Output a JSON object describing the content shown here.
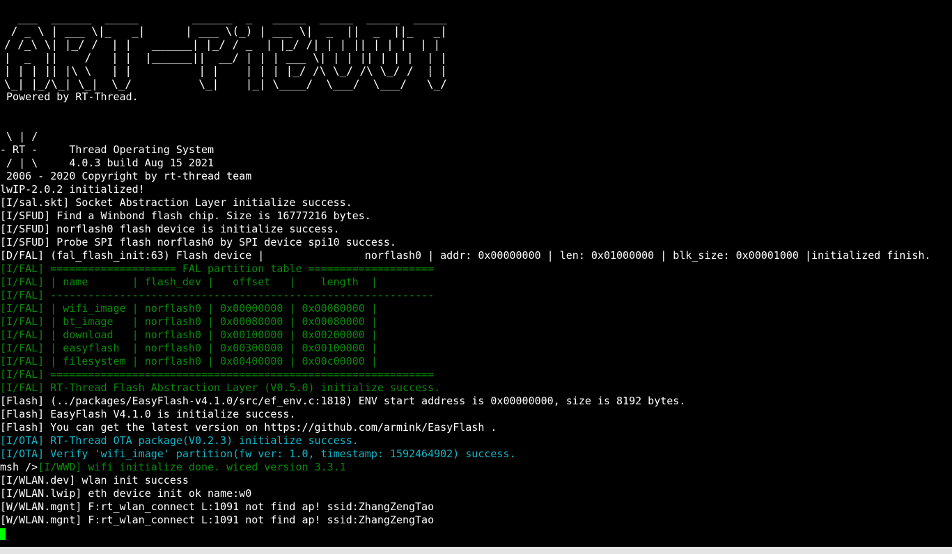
{
  "terminal": {
    "banner_ascii": "  ___  ______  _____        ______  _   _____  _____  _____  _____\n / _ \\ | ___ \\|_   _|      | ___ \\(_) | ___ \\|  _  ||  _  ||_   _|\n/ /_\\ \\| |_/ /  | |   ______| |_/ / _  | |_/ /| | | || | | |  | |\n|  _  ||    /   | |  |______||  __/ | | | ___ \\| | | || | | |  | |\n| | | || |\\ \\   | |          | |    | | | |_/ /\\ \\_/ /\\ \\_/ /  | |\n\\_| |_/\\_| \\_|  \\_/          \\_|    |_| \\____/  \\___/  \\___/   \\_/",
    "lines": [
      {
        "text": " Powered by RT-Thread.",
        "color": "white"
      },
      {
        "text": " \\ | /",
        "color": "white"
      },
      {
        "text": "- RT -     Thread Operating System",
        "color": "white"
      },
      {
        "text": " / | \\     4.0.3 build Aug 15 2021",
        "color": "white"
      },
      {
        "text": " 2006 - 2020 Copyright by rt-thread team",
        "color": "white"
      },
      {
        "text": "lwIP-2.0.2 initialized!",
        "color": "white"
      },
      {
        "text": "[I/sal.skt] Socket Abstraction Layer initialize success.",
        "color": "white"
      },
      {
        "text": "[I/SFUD] Find a Winbond flash chip. Size is 16777216 bytes.",
        "color": "white"
      },
      {
        "text": "[I/SFUD] norflash0 flash device is initialize success.",
        "color": "white"
      },
      {
        "text": "[I/SFUD] Probe SPI flash norflash0 by SPI device spi10 success.",
        "color": "white"
      },
      {
        "text": "[D/FAL] (fal_flash_init:63) Flash device |                norflash0 | addr: 0x00000000 | len: 0x01000000 | blk_size: 0x00001000 |initialized finish.",
        "color": "white"
      },
      {
        "text": "[I/FAL] ==================== FAL partition table ====================",
        "color": "green"
      },
      {
        "text": "[I/FAL] | name       | flash_dev |   offset   |    length  |",
        "color": "green"
      },
      {
        "text": "[I/FAL] -------------------------------------------------------------",
        "color": "green"
      },
      {
        "text": "[I/FAL] | wifi_image | norflash0 | 0x00000000 | 0x00080000 |",
        "color": "green"
      },
      {
        "text": "[I/FAL] | bt_image   | norflash0 | 0x00080000 | 0x00080000 |",
        "color": "green"
      },
      {
        "text": "[I/FAL] | download   | norflash0 | 0x00100000 | 0x00200000 |",
        "color": "green"
      },
      {
        "text": "[I/FAL] | easyflash  | norflash0 | 0x00300000 | 0x00100000 |",
        "color": "green"
      },
      {
        "text": "[I/FAL] | filesystem | norflash0 | 0x00400000 | 0x00c00000 |",
        "color": "green"
      },
      {
        "text": "[I/FAL] =============================================================",
        "color": "green"
      },
      {
        "text": "[I/FAL] RT-Thread Flash Abstraction Layer (V0.5.0) initialize success.",
        "color": "green"
      },
      {
        "text": "[Flash] (../packages/EasyFlash-v4.1.0/src/ef_env.c:1818) ENV start address is 0x00000000, size is 8192 bytes.",
        "color": "white"
      },
      {
        "text": "[Flash] EasyFlash V4.1.0 is initialize success.",
        "color": "white"
      },
      {
        "text": "[Flash] You can get the latest version on https://github.com/armink/EasyFlash .",
        "color": "white"
      },
      {
        "text": "[I/OTA] RT-Thread OTA package(V0.2.3) initialize success.",
        "color": "cyan"
      },
      {
        "text": "[I/OTA] Verify 'wifi_image' partition(fw ver: 1.0, timestamp: 1592464902) success.",
        "color": "cyan"
      },
      {
        "text": "[I/WWD] wifi initialize done. wiced version 3.3.1",
        "color": "green",
        "prefix": "msh />"
      },
      {
        "text": "[I/WLAN.dev] wlan init success",
        "color": "white"
      },
      {
        "text": "[I/WLAN.lwip] eth device init ok name:w0",
        "color": "white"
      },
      {
        "text": "[W/WLAN.mgnt] F:rt_wlan_connect L:1091 not find ap! ssid:ZhangZengTao",
        "color": "white"
      },
      {
        "text": "[W/WLAN.mgnt] F:rt_wlan_connect L:1091 not find ap! ssid:ZhangZengTao",
        "color": "white"
      }
    ]
  },
  "colors": {
    "background": "#000000",
    "text_white": "#ffffff",
    "text_green": "#0a8a0a",
    "text_cyan": "#12b8c8",
    "cursor": "#00ff00"
  }
}
